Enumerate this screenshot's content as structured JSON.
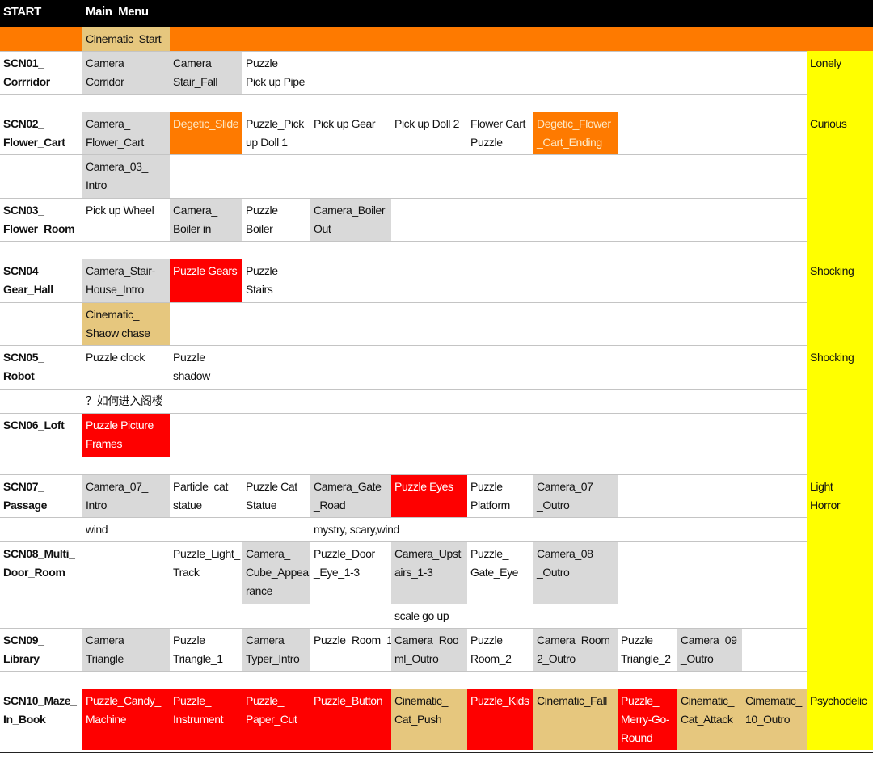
{
  "colors": {
    "w": "#ffffff",
    "g": "#d9d9d9",
    "o": "#fe7a00",
    "r": "#fe0000",
    "t": "#e6c77e",
    "y": "#ffff00",
    "k": "#000000"
  },
  "rows": [
    [
      [
        "START",
        "k"
      ],
      [
        "Main  Menu",
        "k"
      ],
      [
        "",
        "k"
      ],
      [
        "",
        "k"
      ],
      [
        "",
        "k"
      ],
      [
        "",
        "k"
      ],
      [
        "",
        "k"
      ],
      [
        "",
        "k"
      ],
      [
        "",
        "k"
      ],
      [
        "",
        "k"
      ],
      [
        "",
        "k"
      ],
      [
        "",
        "k"
      ]
    ],
    [
      [
        "",
        "o"
      ],
      [
        "Cinematic  Start",
        "t"
      ],
      [
        "",
        "o"
      ],
      [
        "",
        "o"
      ],
      [
        "",
        "o"
      ],
      [
        "",
        "o"
      ],
      [
        "",
        "o"
      ],
      [
        "",
        "o"
      ],
      [
        "",
        "o"
      ],
      [
        "",
        "o"
      ],
      [
        "",
        "o"
      ],
      [
        "",
        "o"
      ]
    ],
    [
      [
        "SCN01_\nCorrridor",
        "w"
      ],
      [
        "Camera_\nCorridor",
        "g"
      ],
      [
        "Camera_\nStair_Fall",
        "g"
      ],
      [
        "Puzzle_\nPick up Pipe",
        "w"
      ],
      [
        "",
        "w"
      ],
      [
        "",
        "w"
      ],
      [
        "",
        "w"
      ],
      [
        "",
        "w"
      ],
      [
        "",
        "w"
      ],
      [
        "",
        "w"
      ],
      [
        "",
        "w"
      ],
      [
        "Lonely",
        "y"
      ]
    ],
    [
      [
        "",
        "w"
      ],
      [
        "",
        "w"
      ],
      [
        "",
        "w"
      ],
      [
        "",
        "w"
      ],
      [
        "",
        "w"
      ],
      [
        "",
        "w"
      ],
      [
        "",
        "w"
      ],
      [
        "",
        "w"
      ],
      [
        "",
        "w"
      ],
      [
        "",
        "w"
      ],
      [
        "",
        "w"
      ],
      [
        "",
        "y"
      ]
    ],
    [
      [
        "SCN02_\nFlower_Cart",
        "w"
      ],
      [
        "Camera_\nFlower_Cart",
        "g"
      ],
      [
        "Degetic_Slide",
        "o"
      ],
      [
        "Puzzle_Pick\nup Doll 1",
        "w"
      ],
      [
        "Pick up Gear",
        "w"
      ],
      [
        "Pick up Doll 2",
        "w"
      ],
      [
        "Flower Cart\nPuzzle",
        "w"
      ],
      [
        "Degetic_Flower\n_Cart_Ending",
        "o"
      ],
      [
        "",
        "w"
      ],
      [
        "",
        "w"
      ],
      [
        "",
        "w"
      ],
      [
        "Curious",
        "y"
      ]
    ],
    [
      [
        "",
        "w"
      ],
      [
        "Camera_03_\nIntro",
        "g"
      ],
      [
        "",
        "w"
      ],
      [
        "",
        "w"
      ],
      [
        "",
        "w"
      ],
      [
        "",
        "w"
      ],
      [
        "",
        "w"
      ],
      [
        "",
        "w"
      ],
      [
        "",
        "w"
      ],
      [
        "",
        "w"
      ],
      [
        "",
        "w"
      ],
      [
        "",
        "y"
      ]
    ],
    [
      [
        "SCN03_\nFlower_Room",
        "w"
      ],
      [
        "Pick up Wheel",
        "w"
      ],
      [
        "Camera_\nBoiler in",
        "g"
      ],
      [
        "Puzzle\nBoiler",
        "w"
      ],
      [
        "Camera_Boiler\nOut",
        "g"
      ],
      [
        "",
        "w"
      ],
      [
        "",
        "w"
      ],
      [
        "",
        "w"
      ],
      [
        "",
        "w"
      ],
      [
        "",
        "w"
      ],
      [
        "",
        "w"
      ],
      [
        "",
        "y"
      ]
    ],
    [
      [
        "",
        "w"
      ],
      [
        "",
        "w"
      ],
      [
        "",
        "w"
      ],
      [
        "",
        "w"
      ],
      [
        "",
        "w"
      ],
      [
        "",
        "w"
      ],
      [
        "",
        "w"
      ],
      [
        "",
        "w"
      ],
      [
        "",
        "w"
      ],
      [
        "",
        "w"
      ],
      [
        "",
        "w"
      ],
      [
        "",
        "y"
      ]
    ],
    [
      [
        "SCN04_\nGear_Hall",
        "w"
      ],
      [
        "Camera_Stair-\nHouse_Intro",
        "g"
      ],
      [
        "Puzzle Gears",
        "r"
      ],
      [
        "Puzzle\nStairs",
        "w"
      ],
      [
        "",
        "w"
      ],
      [
        "",
        "w"
      ],
      [
        "",
        "w"
      ],
      [
        "",
        "w"
      ],
      [
        "",
        "w"
      ],
      [
        "",
        "w"
      ],
      [
        "",
        "w"
      ],
      [
        "Shocking",
        "y"
      ]
    ],
    [
      [
        "",
        "w"
      ],
      [
        "Cinematic_\nShaow chase",
        "t"
      ],
      [
        "",
        "w"
      ],
      [
        "",
        "w"
      ],
      [
        "",
        "w"
      ],
      [
        "",
        "w"
      ],
      [
        "",
        "w"
      ],
      [
        "",
        "w"
      ],
      [
        "",
        "w"
      ],
      [
        "",
        "w"
      ],
      [
        "",
        "w"
      ],
      [
        "",
        "y"
      ]
    ],
    [
      [
        "SCN05_\nRobot",
        "w"
      ],
      [
        "Puzzle clock",
        "w"
      ],
      [
        "Puzzle\nshadow",
        "w"
      ],
      [
        "",
        "w"
      ],
      [
        "",
        "w"
      ],
      [
        "",
        "w"
      ],
      [
        "",
        "w"
      ],
      [
        "",
        "w"
      ],
      [
        "",
        "w"
      ],
      [
        "",
        "w"
      ],
      [
        "",
        "w"
      ],
      [
        "Shocking",
        "y"
      ]
    ],
    [
      [
        "",
        "w"
      ],
      [
        "？如何进入阁楼",
        "w"
      ],
      [
        "",
        "w"
      ],
      [
        "",
        "w"
      ],
      [
        "",
        "w"
      ],
      [
        "",
        "w"
      ],
      [
        "",
        "w"
      ],
      [
        "",
        "w"
      ],
      [
        "",
        "w"
      ],
      [
        "",
        "w"
      ],
      [
        "",
        "w"
      ],
      [
        "",
        "y"
      ]
    ],
    [
      [
        "SCN06_Loft",
        "w"
      ],
      [
        "Puzzle Picture\nFrames",
        "r"
      ],
      [
        "",
        "w"
      ],
      [
        "",
        "w"
      ],
      [
        "",
        "w"
      ],
      [
        "",
        "w"
      ],
      [
        "",
        "w"
      ],
      [
        "",
        "w"
      ],
      [
        "",
        "w"
      ],
      [
        "",
        "w"
      ],
      [
        "",
        "w"
      ],
      [
        "",
        "y"
      ]
    ],
    [
      [
        "",
        "w"
      ],
      [
        "",
        "w"
      ],
      [
        "",
        "w"
      ],
      [
        "",
        "w"
      ],
      [
        "",
        "w"
      ],
      [
        "",
        "w"
      ],
      [
        "",
        "w"
      ],
      [
        "",
        "w"
      ],
      [
        "",
        "w"
      ],
      [
        "",
        "w"
      ],
      [
        "",
        "w"
      ],
      [
        "",
        "y"
      ]
    ],
    [
      [
        "SCN07_\nPassage",
        "w"
      ],
      [
        "Camera_07_\nIntro",
        "g"
      ],
      [
        "Particle  cat\nstatue",
        "w"
      ],
      [
        "Puzzle Cat\nStatue",
        "w"
      ],
      [
        "Camera_Gate\n_Road",
        "g"
      ],
      [
        "Puzzle Eyes",
        "r"
      ],
      [
        "Puzzle\nPlatform",
        "w"
      ],
      [
        "Camera_07\n_Outro",
        "g"
      ],
      [
        "",
        "w"
      ],
      [
        "",
        "w"
      ],
      [
        "",
        "w"
      ],
      [
        "Light\nHorror",
        "y"
      ]
    ],
    [
      [
        "",
        "w"
      ],
      [
        "wind",
        "w"
      ],
      [
        "",
        "w"
      ],
      [
        "",
        "w"
      ],
      [
        "mystry, scary,wind",
        "w"
      ],
      [
        "",
        "w"
      ],
      [
        "",
        "w"
      ],
      [
        "",
        "w"
      ],
      [
        "",
        "w"
      ],
      [
        "",
        "w"
      ],
      [
        "",
        "w"
      ],
      [
        "",
        "y"
      ]
    ],
    [
      [
        "SCN08_Multi_\nDoor_Room",
        "w"
      ],
      [
        "",
        "w"
      ],
      [
        "Puzzle_Light_\nTrack",
        "w"
      ],
      [
        "Camera_\nCube_Appea\nrance",
        "g"
      ],
      [
        "Puzzle_Door\n_Eye_1-3",
        "w"
      ],
      [
        "Camera_Upst\nairs_1-3",
        "g"
      ],
      [
        "Puzzle_\nGate_Eye",
        "w"
      ],
      [
        "Camera_08\n_Outro",
        "g"
      ],
      [
        "",
        "w"
      ],
      [
        "",
        "w"
      ],
      [
        "",
        "w"
      ],
      [
        "",
        "y"
      ]
    ],
    [
      [
        "",
        "w"
      ],
      [
        "",
        "w"
      ],
      [
        "",
        "w"
      ],
      [
        "",
        "w"
      ],
      [
        "",
        "w"
      ],
      [
        "scale go up",
        "w"
      ],
      [
        "",
        "w"
      ],
      [
        "",
        "w"
      ],
      [
        "",
        "w"
      ],
      [
        "",
        "w"
      ],
      [
        "",
        "w"
      ],
      [
        "",
        "y"
      ]
    ],
    [
      [
        "SCN09_\nLibrary",
        "w"
      ],
      [
        "Camera_\nTriangle",
        "g"
      ],
      [
        "Puzzle_\nTriangle_1",
        "w"
      ],
      [
        "Camera_\nTyper_Intro",
        "g"
      ],
      [
        "Puzzle_Room_1",
        "w"
      ],
      [
        "Camera_Roo\nml_Outro",
        "g"
      ],
      [
        "Puzzle_\nRoom_2",
        "w"
      ],
      [
        "Camera_Room\n2_Outro",
        "g"
      ],
      [
        "Puzzle_\nTriangle_2",
        "w"
      ],
      [
        "Camera_09\n_Outro",
        "g"
      ],
      [
        "",
        "w"
      ],
      [
        "",
        "y"
      ]
    ],
    [
      [
        "",
        "w"
      ],
      [
        "",
        "w"
      ],
      [
        "",
        "w"
      ],
      [
        "",
        "w"
      ],
      [
        "",
        "w"
      ],
      [
        "",
        "w"
      ],
      [
        "",
        "w"
      ],
      [
        "",
        "w"
      ],
      [
        "",
        "w"
      ],
      [
        "",
        "w"
      ],
      [
        "",
        "w"
      ],
      [
        "",
        "y"
      ]
    ],
    [
      [
        "SCN10_Maze_\nIn_Book",
        "w"
      ],
      [
        "Puzzle_Candy_\nMachine",
        "r"
      ],
      [
        "Puzzle_\nInstrument",
        "r"
      ],
      [
        "Puzzle_\nPaper_Cut",
        "r"
      ],
      [
        "Puzzle_Button",
        "r"
      ],
      [
        "Cinematic_\nCat_Push",
        "t"
      ],
      [
        "Puzzle_Kids",
        "r"
      ],
      [
        "Cinematic_Fall",
        "t"
      ],
      [
        "Puzzle_\nMerry-Go-\nRound",
        "r"
      ],
      [
        "Cinematic_\nCat_Attack",
        "t"
      ],
      [
        "Cimematic_\n10_Outro",
        "t"
      ],
      [
        "Psychodelic",
        "y"
      ]
    ]
  ]
}
